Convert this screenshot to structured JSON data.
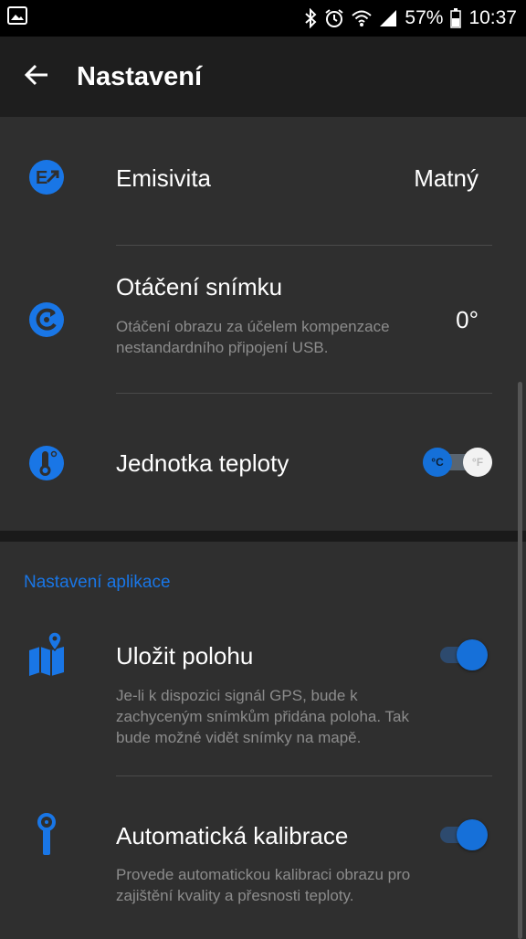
{
  "status_bar": {
    "battery": "57%",
    "time": "10:37",
    "icons": [
      "image-icon",
      "bluetooth-icon",
      "alarm-icon",
      "wifi-icon",
      "signal-icon",
      "battery-icon"
    ]
  },
  "app_bar": {
    "title": "Nastavení",
    "back_icon": "arrow-left-icon"
  },
  "settings": {
    "emissivity": {
      "title": "Emisivita",
      "value": "Matný",
      "icon": "emissivity-icon"
    },
    "rotation": {
      "title": "Otáčení snímku",
      "subtitle": "Otáčení obrazu za účelem kompenzace nestandardního připojení USB.",
      "value": "0°",
      "icon": "rotate-icon"
    },
    "temp_unit": {
      "title": "Jednotka teploty",
      "celsius_label": "°C",
      "fahrenheit_label": "°F",
      "selected": "°C",
      "icon": "thermometer-icon"
    }
  },
  "app_section": {
    "header": "Nastavení aplikace",
    "save_location": {
      "title": "Uložit polohu",
      "subtitle": "Je-li k dispozici signál GPS, bude k zachyceným snímkům přidána poloha. Tak bude možné vidět snímky na mapě.",
      "enabled": true,
      "icon": "map-pin-icon"
    },
    "auto_calibration": {
      "title": "Automatická kalibrace",
      "subtitle": "Provede automatickou kalibraci obrazu pro zajištění kvality a přesnosti teploty.",
      "enabled": true,
      "icon": "calibration-icon"
    }
  },
  "colors": {
    "accent": "#1976e6",
    "background": "#2f2f2f",
    "app_bar": "#1e1e1e",
    "subtitle_text": "#8c8c8c"
  }
}
